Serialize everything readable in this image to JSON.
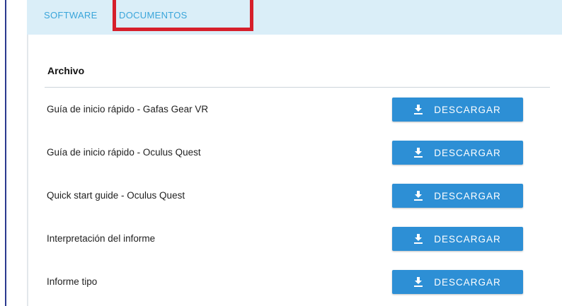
{
  "tabs": {
    "software": "SOFTWARE",
    "documents": "DOCUMENTOS"
  },
  "section": {
    "title": "Archivo"
  },
  "documents": [
    {
      "label": "Guía de inicio rápido - Gafas Gear VR",
      "button": "DESCARGAR"
    },
    {
      "label": "Guía de inicio rápido - Oculus Quest",
      "button": "DESCARGAR"
    },
    {
      "label": "Quick start guide - Oculus Quest",
      "button": "DESCARGAR"
    },
    {
      "label": "Interpretación del informe",
      "button": "DESCARGAR"
    },
    {
      "label": "Informe tipo",
      "button": "DESCARGAR"
    }
  ],
  "icons": {
    "download": "download-icon"
  },
  "colors": {
    "tab_bar_bg": "#daeef8",
    "tab_text": "#3aa5da",
    "highlight": "#d61f2b",
    "button_bg": "#2d8fd5"
  }
}
